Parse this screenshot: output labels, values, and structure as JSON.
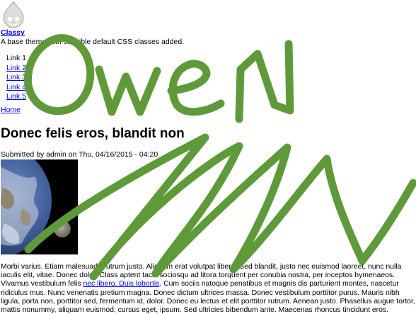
{
  "site": {
    "name": "Classy",
    "slogan": "A base theme with sensible default CSS classes added."
  },
  "menu": {
    "items": [
      {
        "label": "Link 1"
      },
      {
        "label": "Link 2"
      },
      {
        "label": "Link 3"
      },
      {
        "label": "Link 4"
      },
      {
        "label": "Link 5"
      }
    ]
  },
  "breadcrumb": {
    "home": "Home"
  },
  "article": {
    "title": "Donec felis eros, blandit non",
    "submitted": "Submitted by admin on Thu, 04/16/2015 - 04:20",
    "body_before_link": "Morbi varius. Etiam malesuada rutrum justo. Aliquam erat volutpat libero. Sed blandit, justo nec euismod laoreet, nunc nulla iaculis elit, vitae. Donec dolor. Class aptent taciti sociosqu ad litora torquent per conubia nostra, per inceptos hymenaeos. Vivamus vestibulum felis ",
    "body_link": "nec libero. Duis lobortis",
    "body_after_link": ". Cum sociis natoque penatibus et magnis dis parturient montes, nascetur ridiculus mus. Nunc venenatis pretium magna. Donec dictum ultrices massa. Donec vestibulum porttitor purus. Mauris nibh ligula, porta non, porttitor sed, fermentum id, dolor. Donec eu lectus et elit porttitor rutrum. Aenean justo. Phasellus augue tortor, mattis nonummy, aliquam euismod, cursus eget, ipsum. Sed ultricies bibendum ante. Maecenas rhoncus tincidunt eros."
  },
  "overlay": {
    "text": "OweN",
    "color": "#5f9a3a"
  }
}
